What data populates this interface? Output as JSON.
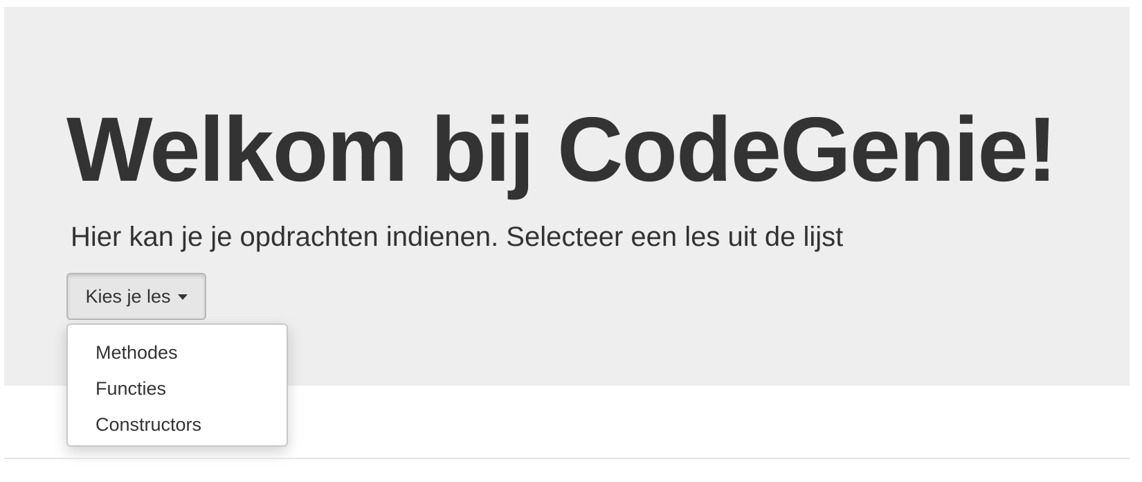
{
  "jumbotron": {
    "title": "Welkom bij CodeGenie!",
    "lead": "Hier kan je je opdrachten indienen. Selecteer een les uit de lijst"
  },
  "dropdown": {
    "toggle_label": "Kies je les",
    "items": [
      {
        "label": "Methodes"
      },
      {
        "label": "Functies"
      },
      {
        "label": "Constructors"
      }
    ]
  },
  "colors": {
    "jumbotron_bg": "#eeeeee",
    "text": "#333333",
    "button_bg": "#e6e6e6"
  }
}
